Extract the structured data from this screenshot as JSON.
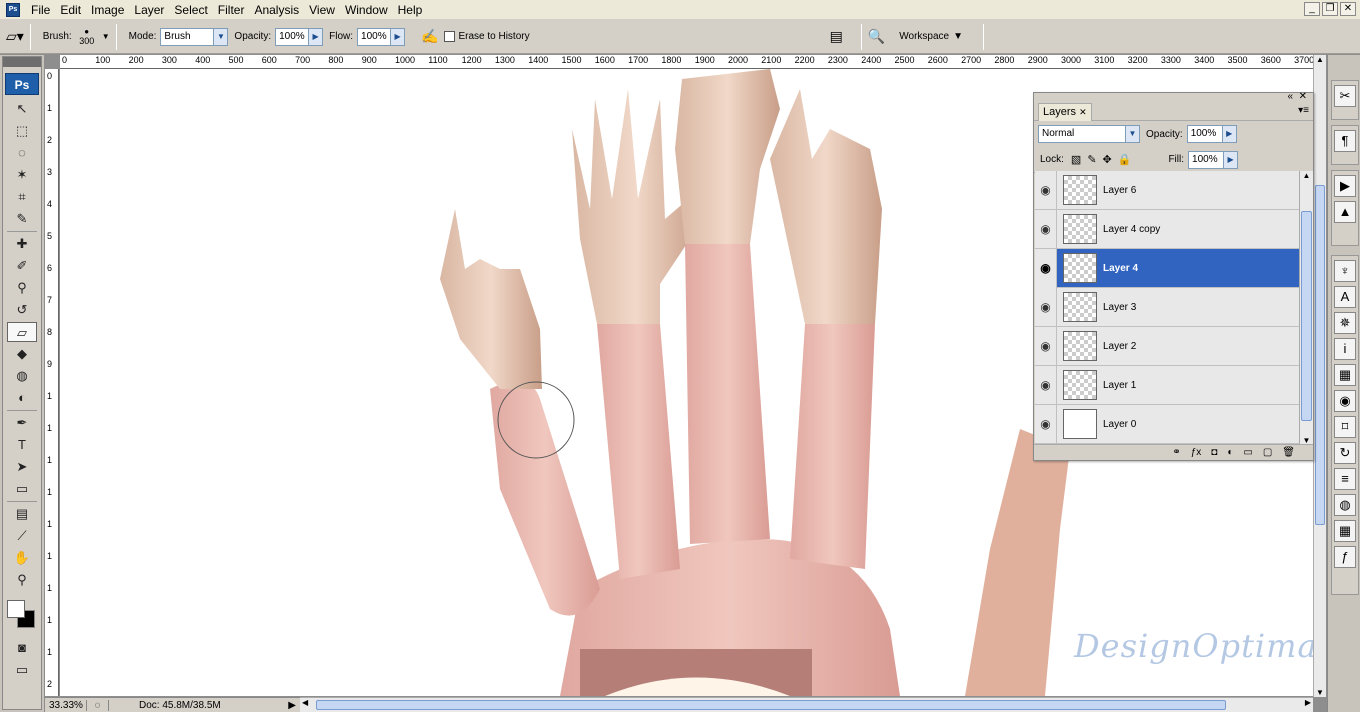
{
  "app": {
    "logo": "Ps"
  },
  "menu": [
    "File",
    "Edit",
    "Image",
    "Layer",
    "Select",
    "Filter",
    "Analysis",
    "View",
    "Window",
    "Help"
  ],
  "window_controls": [
    "minimize",
    "restore",
    "close"
  ],
  "options": {
    "brush_label": "Brush:",
    "brush_size": "300",
    "mode_label": "Mode:",
    "mode_value": "Brush",
    "opacity_label": "Opacity:",
    "opacity_value": "100%",
    "flow_label": "Flow:",
    "flow_value": "100%",
    "erase_history_label": "Erase to History",
    "workspace_label": "Workspace"
  },
  "ruler_h": [
    "0",
    "100",
    "200",
    "300",
    "400",
    "500",
    "600",
    "700",
    "800",
    "900",
    "1000",
    "1100",
    "1200",
    "1300",
    "1400",
    "1500",
    "1600",
    "1700",
    "1800",
    "1900",
    "2000",
    "2100",
    "2200",
    "2300",
    "2400",
    "2500",
    "2600",
    "2700",
    "2800",
    "2900",
    "3000",
    "3100",
    "3200",
    "3300",
    "3400",
    "3500",
    "3600",
    "3700"
  ],
  "ruler_v": [
    "0",
    "1",
    "2",
    "3",
    "4",
    "5",
    "6",
    "7",
    "8",
    "9",
    "1",
    "1",
    "1",
    "1",
    "1",
    "1",
    "1",
    "1",
    "1",
    "2"
  ],
  "tools": [
    {
      "name": "move-tool-icon",
      "glyph": "↖"
    },
    {
      "name": "marquee-tool-icon",
      "glyph": "⬚"
    },
    {
      "name": "lasso-tool-icon",
      "glyph": "◌"
    },
    {
      "name": "magic-wand-tool-icon",
      "glyph": "✶"
    },
    {
      "name": "crop-tool-icon",
      "glyph": "⌗"
    },
    {
      "name": "slice-tool-icon",
      "glyph": "✎"
    },
    {
      "name": "healing-brush-tool-icon",
      "glyph": "✚"
    },
    {
      "name": "brush-tool-icon",
      "glyph": "✐"
    },
    {
      "name": "clone-stamp-tool-icon",
      "glyph": "⚲"
    },
    {
      "name": "history-brush-tool-icon",
      "glyph": "↺"
    },
    {
      "name": "eraser-tool-icon",
      "glyph": "▱",
      "active": true
    },
    {
      "name": "paint-bucket-tool-icon",
      "glyph": "◆"
    },
    {
      "name": "blur-tool-icon",
      "glyph": "◍"
    },
    {
      "name": "dodge-tool-icon",
      "glyph": "◐"
    },
    {
      "name": "pen-tool-icon",
      "glyph": "✒"
    },
    {
      "name": "type-tool-icon",
      "glyph": "T"
    },
    {
      "name": "path-selection-tool-icon",
      "glyph": "➤"
    },
    {
      "name": "shape-tool-icon",
      "glyph": "▭"
    },
    {
      "name": "notes-tool-icon",
      "glyph": "▤"
    },
    {
      "name": "eyedropper-tool-icon",
      "glyph": "⟋"
    },
    {
      "name": "hand-tool-icon",
      "glyph": "✋"
    },
    {
      "name": "zoom-tool-icon",
      "glyph": "⚲"
    }
  ],
  "status": {
    "zoom": "33.33%",
    "doc": "Doc: 45.8M/38.5M"
  },
  "layers_panel": {
    "tab": "Layers",
    "blend_mode": "Normal",
    "opacity_label": "Opacity:",
    "opacity_value": "100%",
    "lock_label": "Lock:",
    "fill_label": "Fill:",
    "fill_value": "100%",
    "layers": [
      {
        "name": "Layer 6",
        "selected": false,
        "thumb": "checker"
      },
      {
        "name": "Layer 4 copy",
        "selected": false,
        "thumb": "checker"
      },
      {
        "name": "Layer 4",
        "selected": true,
        "thumb": "checker"
      },
      {
        "name": "Layer 3",
        "selected": false,
        "thumb": "checker"
      },
      {
        "name": "Layer 2",
        "selected": false,
        "thumb": "checker"
      },
      {
        "name": "Layer 1",
        "selected": false,
        "thumb": "checker"
      },
      {
        "name": "Layer 0",
        "selected": false,
        "thumb": "white"
      }
    ],
    "footer_icons": [
      "link-icon",
      "fx-icon",
      "mask-icon",
      "adjustment-icon",
      "group-icon",
      "new-layer-icon",
      "trash-icon"
    ]
  },
  "dock_icons": [
    "tools-icon",
    "paragraph-icon",
    "actions-icon",
    "histogram-icon",
    "clone-source-icon",
    "character-icon",
    "navigator-icon",
    "info-icon",
    "layer-comps-icon",
    "styles-icon",
    "paths-icon",
    "history-icon",
    "channels-icon",
    "swatches-icon",
    "brushes-icon",
    "fx-icon"
  ],
  "watermark": "DesignOptimal.com",
  "colors": {
    "accent": "#3064c0",
    "ps_blue": "#1f5ea8",
    "ui_bg": "#d4d0c8"
  }
}
